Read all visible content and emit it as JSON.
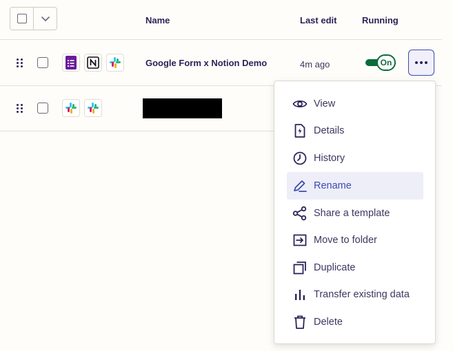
{
  "header": {
    "name_col": "Name",
    "last_edit_col": "Last edit",
    "running_col": "Running"
  },
  "rows": [
    {
      "name": "Google Form x Notion Demo",
      "last_edit": "4m ago",
      "status": "On",
      "apps": [
        "google-forms-icon",
        "notion-icon",
        "slack-icon"
      ]
    },
    {
      "name": "",
      "apps": [
        "slack-icon",
        "slack-icon"
      ]
    }
  ],
  "menu": {
    "items": [
      {
        "label": "View",
        "icon": "eye-icon"
      },
      {
        "label": "Details",
        "icon": "details-icon"
      },
      {
        "label": "History",
        "icon": "clock-icon"
      },
      {
        "label": "Rename",
        "icon": "pen-icon"
      },
      {
        "label": "Share a template",
        "icon": "share-icon"
      },
      {
        "label": "Move to folder",
        "icon": "move-folder-icon"
      },
      {
        "label": "Duplicate",
        "icon": "duplicate-icon"
      },
      {
        "label": "Transfer existing data",
        "icon": "bar-chart-icon"
      },
      {
        "label": "Delete",
        "icon": "trash-icon"
      }
    ],
    "highlighted": "Rename"
  },
  "colors": {
    "toggle_on": "#0b6b3a",
    "accent": "#3d4bab",
    "highlight_bg": "#eeeef9",
    "text": "#2b2358"
  }
}
